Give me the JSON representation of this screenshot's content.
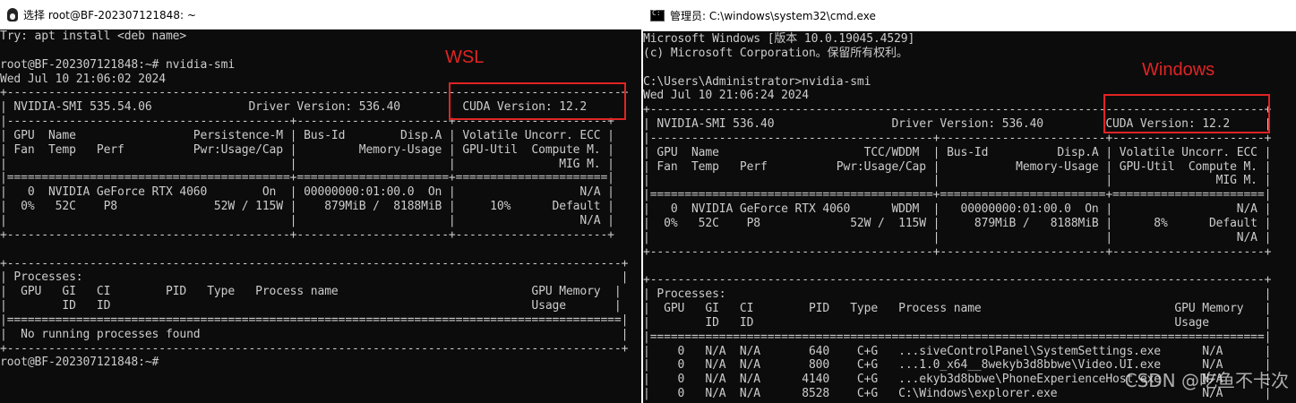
{
  "left_window": {
    "title": "选择 root@BF-202307121848: ~",
    "lines": [
      "Try: apt install <deb name>",
      "",
      "root@BF-202307121848:~# nvidia-smi",
      "Wed Jul 10 21:06:02 2024",
      "+-----------------------------------------------------------------------------------------+",
      "| NVIDIA-SMI 535.54.06              Driver Version: 536.40         CUDA Version: 12.2     |",
      "|-----------------------------------------+----------------------+----------------------+",
      "| GPU  Name                 Persistence-M | Bus-Id        Disp.A | Volatile Uncorr. ECC |",
      "| Fan  Temp   Perf          Pwr:Usage/Cap |         Memory-Usage | GPU-Util  Compute M. |",
      "|                                         |                      |               MIG M. |",
      "|=========================================+======================+======================|",
      "|   0  NVIDIA GeForce RTX 4060        On  | 00000000:01:00.0  On |                  N/A |",
      "|  0%   52C    P8              52W / 115W |    879MiB /  8188MiB |     10%      Default |",
      "|                                         |                      |                  N/A |",
      "+-----------------------------------------+----------------------+----------------------+",
      "",
      "+-----------------------------------------------------------------------------------------+",
      "| Processes:                                                                              |",
      "|  GPU   GI   CI        PID   Type   Process name                            GPU Memory  |",
      "|        ID   ID                                                             Usage       |",
      "|=========================================================================================|",
      "|  No running processes found                                                             |",
      "+-----------------------------------------------------------------------------------------+",
      "root@BF-202307121848:~#"
    ]
  },
  "right_window": {
    "title": "管理员: C:\\windows\\system32\\cmd.exe",
    "lines": [
      "Microsoft Windows [版本 10.0.19045.4529]",
      "(c) Microsoft Corporation。保留所有权利。",
      "",
      "C:\\Users\\Administrator>nvidia-smi",
      "Wed Jul 10 21:06:24 2024",
      "+-----------------------------------------------------------------------------------------+",
      "| NVIDIA-SMI 536.40                 Driver Version: 536.40         CUDA Version: 12.2     |",
      "|-----------------------------------------+------------------------+----------------------+",
      "| GPU  Name                     TCC/WDDM  | Bus-Id          Disp.A | Volatile Uncorr. ECC |",
      "| Fan  Temp   Perf          Pwr:Usage/Cap |           Memory-Usage | GPU-Util  Compute M. |",
      "|                                         |                        |               MIG M. |",
      "|=========================================+========================+======================|",
      "|   0  NVIDIA GeForce RTX 4060      WDDM  |   00000000:01:00.0  On |                  N/A |",
      "|  0%   52C    P8             52W /  115W |     879MiB /   8188MiB |      8%      Default |",
      "|                                         |                        |                  N/A |",
      "+-----------------------------------------+------------------------+----------------------+",
      "",
      "+-----------------------------------------------------------------------------------------+",
      "| Processes:                                                                              |",
      "|  GPU   GI   CI        PID   Type   Process name                            GPU Memory   |",
      "|        ID   ID                                                             Usage        |",
      "|=========================================================================================|",
      "|    0   N/A  N/A       640    C+G   ...siveControlPanel\\SystemSettings.exe      N/A      |",
      "|    0   N/A  N/A       800    C+G   ...1.0_x64__8wekyb3d8bbwe\\Video.UI.exe      N/A      |",
      "|    0   N/A  N/A      4140    C+G   ...ekyb3d8bbwe\\PhoneExperienceHost.exe      N/A      |",
      "|    0   N/A  N/A      8528    C+G   C:\\Windows\\explorer.exe                     N/A      |"
    ]
  },
  "annotations": {
    "wsl_label": "WSL",
    "windows_label": "Windows",
    "color": "#e02424"
  },
  "watermark": "CSDN @吃鱼不卡次"
}
